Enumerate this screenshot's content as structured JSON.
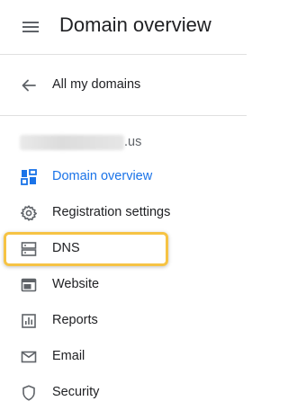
{
  "header": {
    "menu_icon": "hamburger-menu-icon",
    "title": "Domain overview"
  },
  "back": {
    "icon": "arrow-back-icon",
    "label": "All my domains"
  },
  "domain": {
    "tld": ".us"
  },
  "nav": {
    "items": [
      {
        "label": "Domain overview",
        "icon": "dashboard-icon",
        "active": true
      },
      {
        "label": "Registration settings",
        "icon": "gear-icon",
        "active": false
      },
      {
        "label": "DNS",
        "icon": "dns-icon",
        "active": false,
        "highlighted": true
      },
      {
        "label": "Website",
        "icon": "web-icon",
        "active": false
      },
      {
        "label": "Reports",
        "icon": "bar-chart-icon",
        "active": false
      },
      {
        "label": "Email",
        "icon": "email-icon",
        "active": false
      },
      {
        "label": "Security",
        "icon": "shield-icon",
        "active": false
      }
    ]
  },
  "colors": {
    "accent": "#1a73e8",
    "icon_default": "#5f6368",
    "highlight_border": "#f6c344",
    "divider": "#e0e0e0"
  }
}
